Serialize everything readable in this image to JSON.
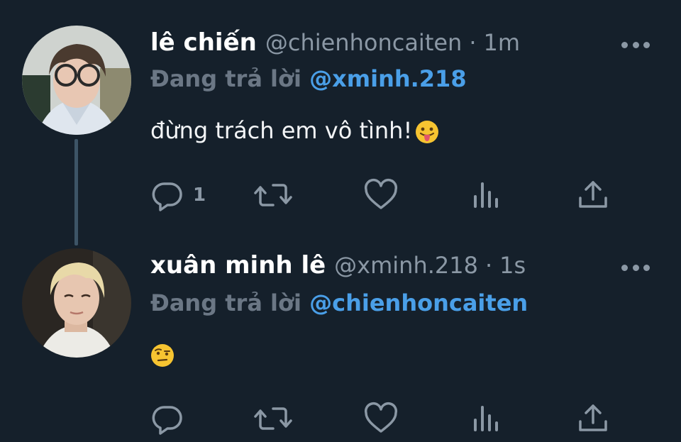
{
  "tweets": [
    {
      "name": "lê chiến",
      "handle": "@chienhoncaiten",
      "separator": "·",
      "time": "1m",
      "reply_prefix": "Đang trả lời",
      "reply_to": "@xminh.218",
      "text": "đừng trách em vô tình!",
      "emoji": "tongue-out-emoji",
      "reply_count": "1",
      "icons": [
        "reply-icon",
        "retweet-icon",
        "like-icon",
        "views-icon",
        "share-icon"
      ]
    },
    {
      "name": "xuân minh lê",
      "handle": "@xminh.218",
      "separator": "·",
      "time": "1s",
      "reply_prefix": "Đang trả lời",
      "reply_to": "@chienhoncaiten",
      "text": "",
      "emoji": "raised-eyebrow-emoji",
      "reply_count": "",
      "icons": [
        "reply-icon",
        "retweet-icon",
        "like-icon",
        "views-icon",
        "share-icon"
      ]
    }
  ],
  "colors": {
    "background": "#15202b",
    "accent": "#4a9fe8",
    "muted": "#8b98a5",
    "text": "#ffffff"
  }
}
